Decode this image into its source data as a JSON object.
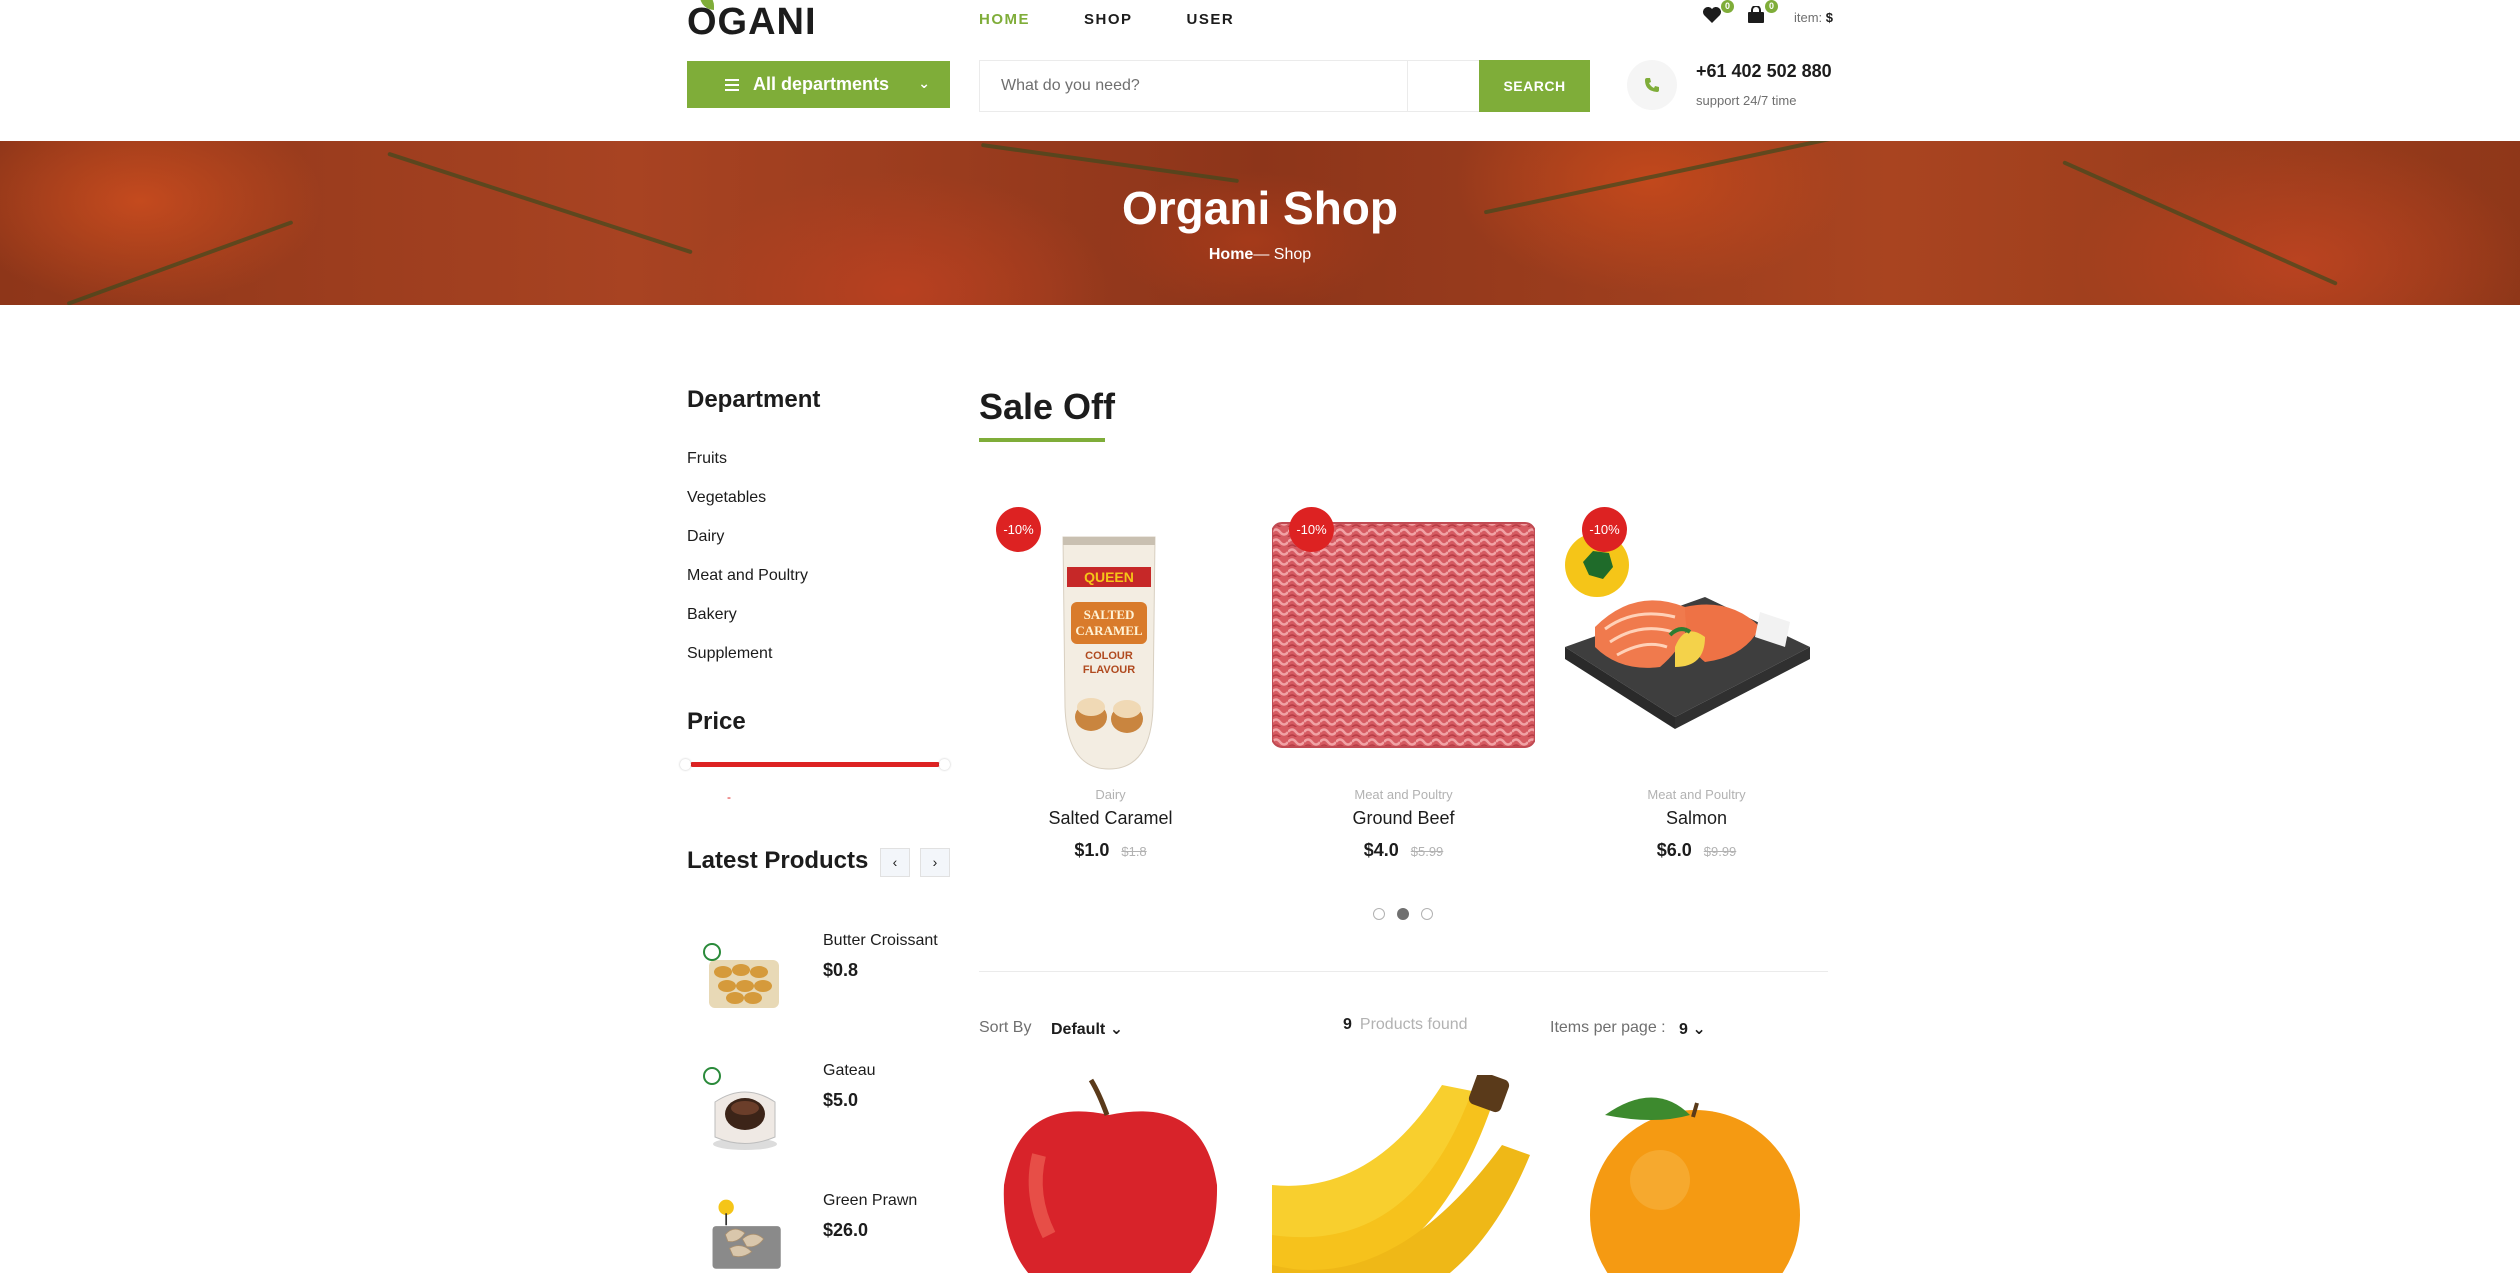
{
  "header": {
    "logo": "OGANI",
    "nav": [
      {
        "label": "HOME",
        "active": true
      },
      {
        "label": "SHOP",
        "active": false
      },
      {
        "label": "USER",
        "active": false
      }
    ],
    "wishlist_count": "0",
    "cart_count": "0",
    "item_label": "item:",
    "item_value": "$",
    "departments_label": "All departments",
    "search_placeholder": "What do you need?",
    "search_button": "SEARCH",
    "phone": "+61 402 502 880",
    "support": "support 24/7 time"
  },
  "banner": {
    "title": "Organi Shop",
    "breadcrumb_home": "Home",
    "breadcrumb_sep": "— ",
    "breadcrumb_current": "Shop"
  },
  "sidebar": {
    "department_title": "Department",
    "departments": [
      "Fruits",
      "Vegetables",
      "Dairy",
      "Meat and Poultry",
      "Bakery",
      "Supplement"
    ],
    "price_title": "Price",
    "price_label": "-",
    "latest_title": "Latest Products",
    "latest_prev": "‹",
    "latest_next": "›",
    "latest": [
      {
        "name": "Butter Croissant",
        "price": "$0.8"
      },
      {
        "name": "Gateau",
        "price": "$5.0"
      },
      {
        "name": "Green Prawn",
        "price": "$26.0"
      }
    ]
  },
  "main": {
    "sale_title": "Sale Off",
    "sale_items": [
      {
        "discount": "-10%",
        "category": "Dairy",
        "name": "Salted Caramel",
        "price": "$1.0",
        "old_price": "$1.8"
      },
      {
        "discount": "-10%",
        "category": "Meat and Poultry",
        "name": "Ground Beef",
        "price": "$4.0",
        "old_price": "$5.99"
      },
      {
        "discount": "-10%",
        "category": "Meat and Poultry",
        "name": "Salmon",
        "price": "$6.0",
        "old_price": "$9.99"
      }
    ],
    "carousel_active_dot": 2,
    "sort_label": "Sort By",
    "sort_value": "Default",
    "found_count": "9",
    "found_label": "Products found",
    "per_page_label": "Items per page :",
    "per_page_value": "9"
  },
  "colors": {
    "accent": "#7fad39",
    "sale": "#dd2222",
    "text": "#1c1c1c",
    "muted": "#b2b2b2"
  }
}
